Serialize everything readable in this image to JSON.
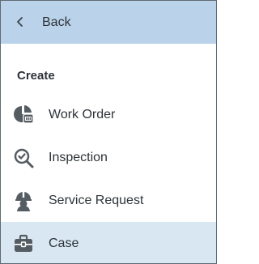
{
  "header": {
    "back_label": "Back",
    "back_icon": "chevron-left-icon"
  },
  "section": {
    "title": "Create"
  },
  "menu": {
    "items": [
      {
        "label": "Work Order",
        "icon": "work-order-icon",
        "selected": false
      },
      {
        "label": "Inspection",
        "icon": "inspection-icon",
        "selected": false
      },
      {
        "label": "Service Request",
        "icon": "service-request-icon",
        "selected": false
      },
      {
        "label": "Case",
        "icon": "briefcase-icon",
        "selected": true
      }
    ]
  },
  "colors": {
    "header_background": "#bad3ea",
    "selected_background": "#d8e7f2",
    "text": "#2d3338",
    "icon": "#555d63",
    "border": "#5f6a72"
  }
}
